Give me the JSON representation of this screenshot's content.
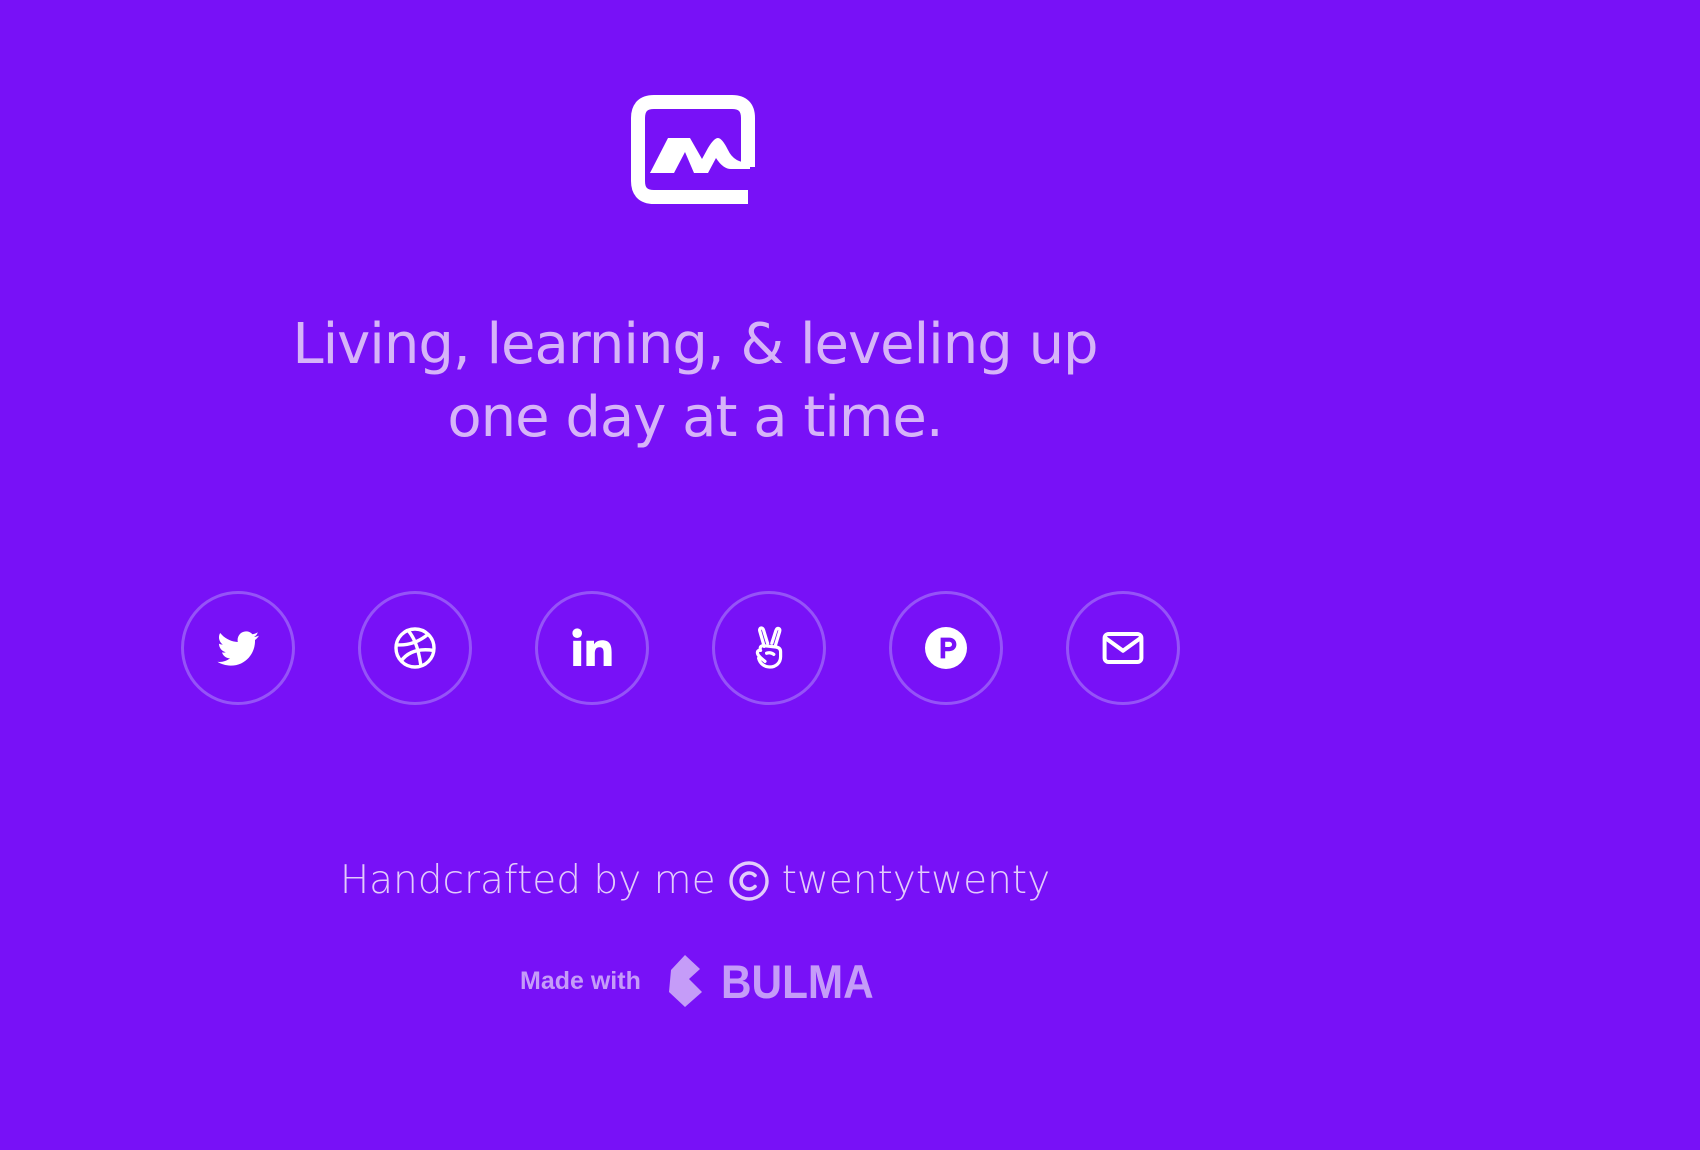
{
  "colors": {
    "background": "#7811f7",
    "tagline": "#d6b4f8",
    "circle_border": "#9553f7",
    "icon": "#ffffff",
    "credit": "#e2cbfb",
    "bulma": "#c59cf8"
  },
  "logo": {
    "icon": "logo-m-icon"
  },
  "tagline": {
    "line1": "Living, learning, & leveling up",
    "line2": "one day at a time."
  },
  "social": [
    {
      "name": "twitter",
      "icon": "twitter-icon"
    },
    {
      "name": "dribbble",
      "icon": "dribbble-icon"
    },
    {
      "name": "linkedin",
      "icon": "linkedin-icon"
    },
    {
      "name": "angellist",
      "icon": "angellist-icon"
    },
    {
      "name": "producthunt",
      "icon": "producthunt-icon"
    },
    {
      "name": "email",
      "icon": "envelope-icon"
    }
  ],
  "footer": {
    "credit_prefix": "Handcrafted by me",
    "credit_suffix": "twentytwenty",
    "made_with": "Made with",
    "bulma": "BULMA"
  }
}
